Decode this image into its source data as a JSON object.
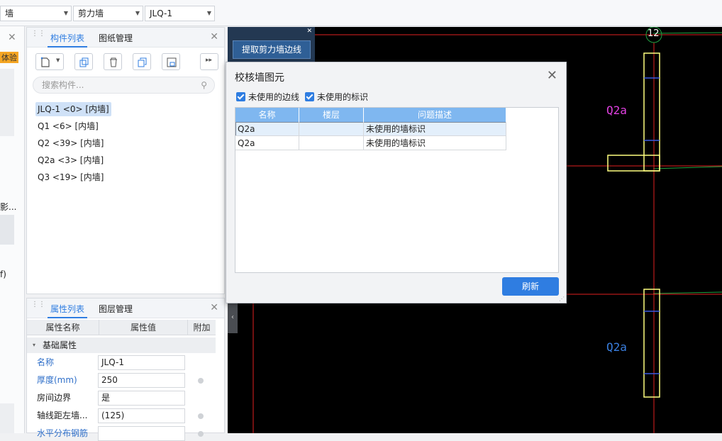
{
  "toolbar": {
    "combo1": "墙",
    "combo2": "剪力墙",
    "combo3": "JLQ-1"
  },
  "left_strip": {
    "badge": "体验",
    "text1": "影...",
    "text2": "f)"
  },
  "component_panel": {
    "tab_active": "构件列表",
    "tab_other": "图纸管理",
    "search_placeholder": "搜索构件...",
    "items": [
      {
        "label": "JLQ-1 <0> [内墙]",
        "selected": true
      },
      {
        "label": "Q1 <6> [内墙]",
        "selected": false
      },
      {
        "label": "Q2 <39> [内墙]",
        "selected": false
      },
      {
        "label": "Q2a <3> [内墙]",
        "selected": false
      },
      {
        "label": "Q3 <19> [内墙]",
        "selected": false
      }
    ]
  },
  "properties_panel": {
    "tab_active": "属性列表",
    "tab_other": "图层管理",
    "col_name": "属性名称",
    "col_value": "属性值",
    "col_extra": "附加",
    "group": "基础属性",
    "rows": [
      {
        "name": "名称",
        "value": "JLQ-1"
      },
      {
        "name": "厚度(mm)",
        "value": "250"
      },
      {
        "name": "房间边界",
        "value": "是"
      },
      {
        "name": "轴线距左墙...",
        "value": "(125)"
      },
      {
        "name": "水平分布钢筋",
        "value": ""
      }
    ]
  },
  "extract": {
    "button": "提取剪力墙边线"
  },
  "cad": {
    "axis_label": "12",
    "label_top": "Q2a",
    "label_bottom": "Q2a",
    "color_magenta": "#e040e0",
    "color_blue": "#3a7fe0",
    "color_red": "#e02020",
    "color_green": "#20a040",
    "color_yellow": "#ffff80"
  },
  "dialog": {
    "title": "校核墙图元",
    "check1": "未使用的边线",
    "check2": "未使用的标识",
    "columns": [
      "名称",
      "楼层",
      "问题描述"
    ],
    "rows": [
      {
        "name": "Q2a",
        "floor": "",
        "desc": "未使用的墙标识"
      },
      {
        "name": "Q2a",
        "floor": "",
        "desc": "未使用的墙标识"
      }
    ],
    "refresh": "刷新"
  }
}
